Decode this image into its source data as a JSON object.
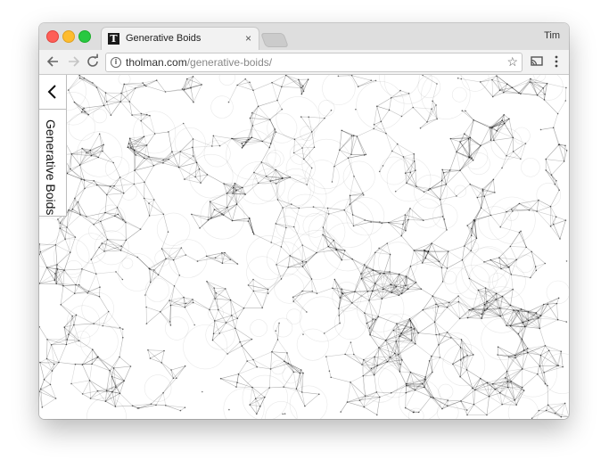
{
  "browser": {
    "tab_title": "Generative Boids",
    "tab_favicon": "T",
    "tab_close": "×",
    "profile_name": "Tim",
    "url_domain": "tholman.com",
    "url_path": "/generative-boids/",
    "icons": {
      "back": "back-arrow-icon",
      "forward": "forward-arrow-icon",
      "reload": "reload-icon",
      "info": "info-icon",
      "bookmark": "star-icon",
      "cast": "cast-icon",
      "menu": "kebab-menu-icon"
    }
  },
  "page": {
    "side_title": "Generative Boids",
    "back_icon": "chevron-left-icon"
  },
  "colors": {
    "titlebar": "#dedede",
    "toolbar": "#f2f2f2",
    "canvas_background": "#ffffff",
    "mesh": "#000000"
  }
}
